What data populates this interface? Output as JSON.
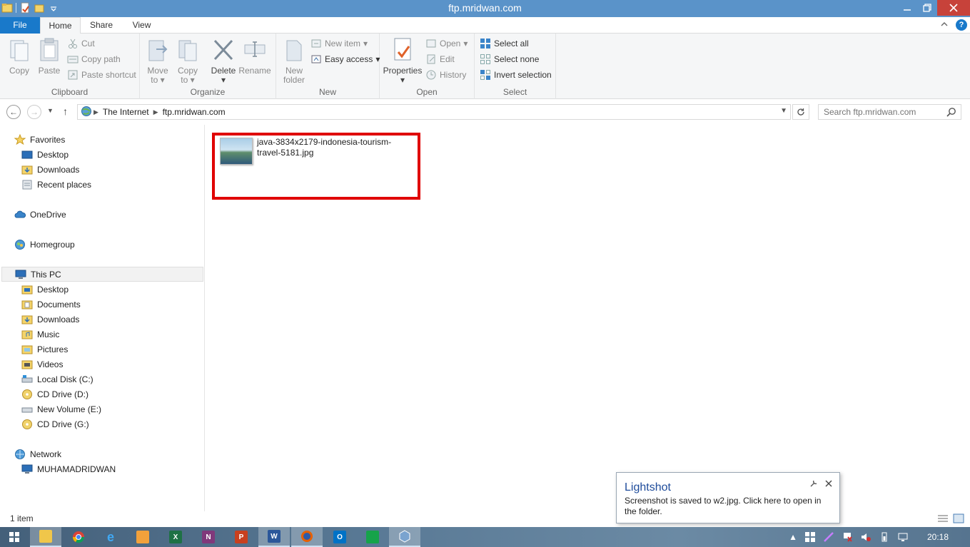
{
  "window": {
    "title": "ftp.mridwan.com"
  },
  "ribbon_tabs": {
    "file": "File",
    "home": "Home",
    "share": "Share",
    "view": "View"
  },
  "ribbon": {
    "clipboard": {
      "label": "Clipboard",
      "copy": "Copy",
      "paste": "Paste",
      "cut": "Cut",
      "copy_path": "Copy path",
      "paste_shortcut": "Paste shortcut"
    },
    "organize": {
      "label": "Organize",
      "move_to": "Move",
      "move_to2": "to",
      "copy_to": "Copy",
      "copy_to2": "to",
      "delete": "Delete",
      "rename": "Rename"
    },
    "new": {
      "label": "New",
      "new_folder": "New",
      "new_folder2": "folder",
      "new_item": "New item",
      "easy_access": "Easy access"
    },
    "open": {
      "label": "Open",
      "properties": "Properties",
      "open": "Open",
      "edit": "Edit",
      "history": "History"
    },
    "select": {
      "label": "Select",
      "select_all": "Select all",
      "select_none": "Select none",
      "invert_selection": "Invert selection"
    }
  },
  "address": {
    "crumbs": [
      "The Internet",
      "ftp.mridwan.com"
    ],
    "search_placeholder": "Search ftp.mridwan.com"
  },
  "nav": {
    "favorites": "Favorites",
    "fav_desktop": "Desktop",
    "fav_downloads": "Downloads",
    "fav_recent": "Recent places",
    "onedrive": "OneDrive",
    "homegroup": "Homegroup",
    "this_pc": "This PC",
    "pc_desktop": "Desktop",
    "pc_documents": "Documents",
    "pc_downloads": "Downloads",
    "pc_music": "Music",
    "pc_pictures": "Pictures",
    "pc_videos": "Videos",
    "local_disk": "Local Disk (C:)",
    "cd_d": "CD Drive (D:)",
    "new_volume": "New Volume (E:)",
    "cd_g": "CD Drive (G:)",
    "network": "Network",
    "computer": "MUHAMADRIDWAN"
  },
  "content": {
    "file_name_line1": "java-3834x2179-indonesia-tourism-",
    "file_name_line2": "travel-5181.jpg"
  },
  "status": {
    "item_count": "1 item"
  },
  "toast": {
    "title": "Lightshot",
    "message": "Screenshot is saved to w2.jpg. Click here to open in the folder."
  },
  "taskbar": {
    "clock": "20:18"
  },
  "colors": {
    "titlebar": "#5a93c9",
    "file_tab": "#1979ca",
    "highlight": "#e00000",
    "close": "#c7423a"
  }
}
